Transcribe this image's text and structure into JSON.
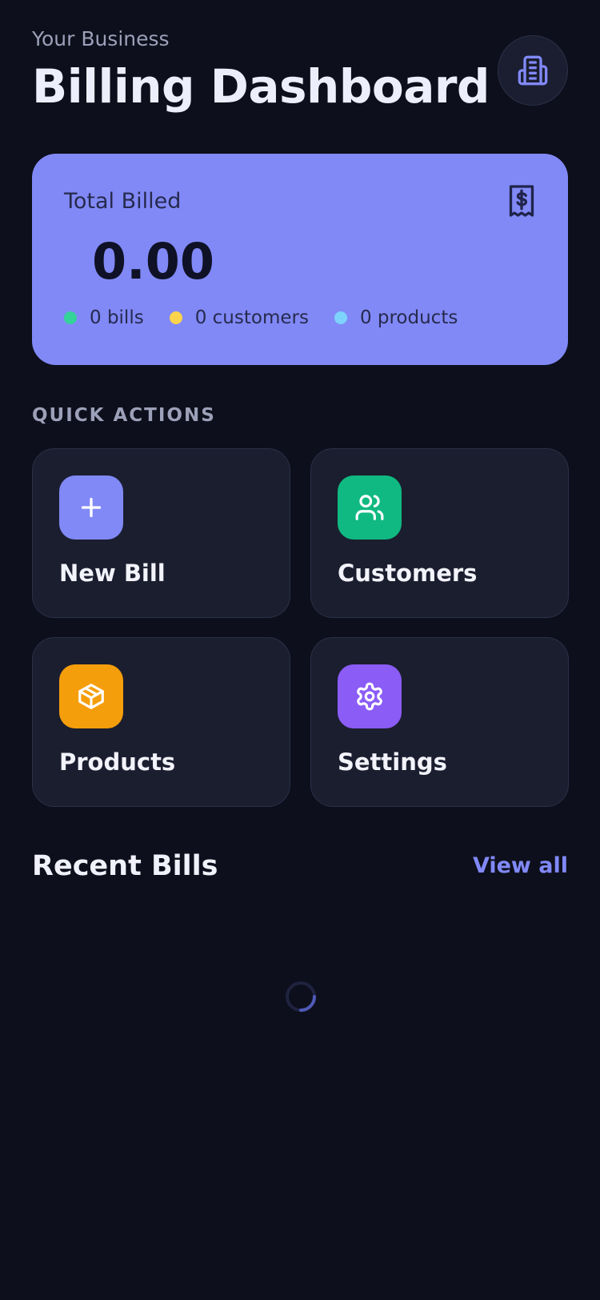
{
  "header": {
    "subtitle": "Your Business",
    "title": "Billing Dashboard",
    "icon": "building-icon"
  },
  "summary": {
    "label": "Total Billed",
    "amount": "0.00",
    "icon": "receipt-dollar-icon",
    "stats": [
      {
        "text": "0 bills",
        "color": "#34d399"
      },
      {
        "text": "0 customers",
        "color": "#fcd34d"
      },
      {
        "text": "0 products",
        "color": "#7dd3fc"
      }
    ]
  },
  "quick_actions": {
    "label": "QUICK ACTIONS",
    "items": [
      {
        "label": "New Bill",
        "icon": "plus-icon",
        "color": "#8189f7"
      },
      {
        "label": "Customers",
        "icon": "users-icon",
        "color": "#10b981"
      },
      {
        "label": "Products",
        "icon": "package-icon",
        "color": "#f59e0b"
      },
      {
        "label": "Settings",
        "icon": "gear-icon",
        "color": "#8b5cf6"
      }
    ]
  },
  "recent": {
    "title": "Recent Bills",
    "view_all": "View all",
    "state": "loading"
  },
  "colors": {
    "background": "#0d0f1c",
    "accent": "#8189f7",
    "card": "#1b1e2f"
  }
}
